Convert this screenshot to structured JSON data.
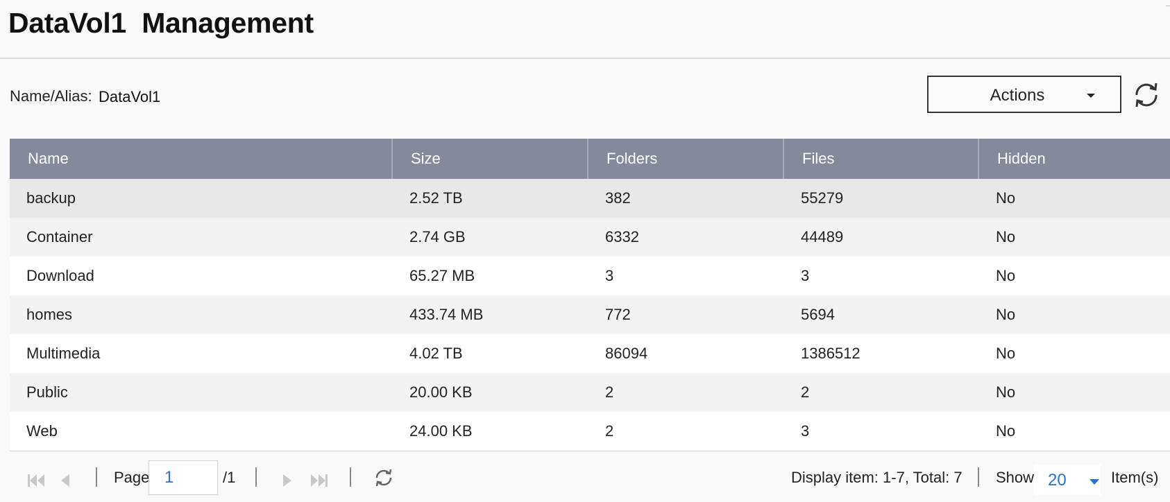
{
  "header": {
    "title": "DataVol1  Management"
  },
  "toolbar": {
    "alias_label": "Name/Alias:",
    "alias_value": "DataVol1",
    "actions_label": "Actions"
  },
  "table": {
    "columns": [
      "Name",
      "Size",
      "Folders",
      "Files",
      "Hidden"
    ],
    "rows": [
      {
        "name": "backup",
        "size": "2.52 TB",
        "folders": "382",
        "files": "55279",
        "hidden": "No"
      },
      {
        "name": "Container",
        "size": "2.74 GB",
        "folders": "6332",
        "files": "44489",
        "hidden": "No"
      },
      {
        "name": "Download",
        "size": "65.27 MB",
        "folders": "3",
        "files": "3",
        "hidden": "No"
      },
      {
        "name": "homes",
        "size": "433.74 MB",
        "folders": "772",
        "files": "5694",
        "hidden": "No"
      },
      {
        "name": "Multimedia",
        "size": "4.02 TB",
        "folders": "86094",
        "files": "1386512",
        "hidden": "No"
      },
      {
        "name": "Public",
        "size": "20.00 KB",
        "folders": "2",
        "files": "2",
        "hidden": "No"
      },
      {
        "name": "Web",
        "size": "24.00 KB",
        "folders": "2",
        "files": "3",
        "hidden": "No"
      }
    ]
  },
  "pager": {
    "page_label": "Page",
    "page_value": "1",
    "page_total": "/1",
    "display_info": "Display item: 1-7, Total: 7",
    "show_label": "Show",
    "show_value": "20",
    "items_label": "Item(s)"
  },
  "colors": {
    "header_bg": "#848a99",
    "accent_blue": "#2b6fd6"
  },
  "icons": {
    "refresh": "refresh-icon",
    "first_page": "first-page-icon",
    "prev_page": "prev-page-icon",
    "next_page": "next-page-icon",
    "last_page": "last-page-icon"
  }
}
